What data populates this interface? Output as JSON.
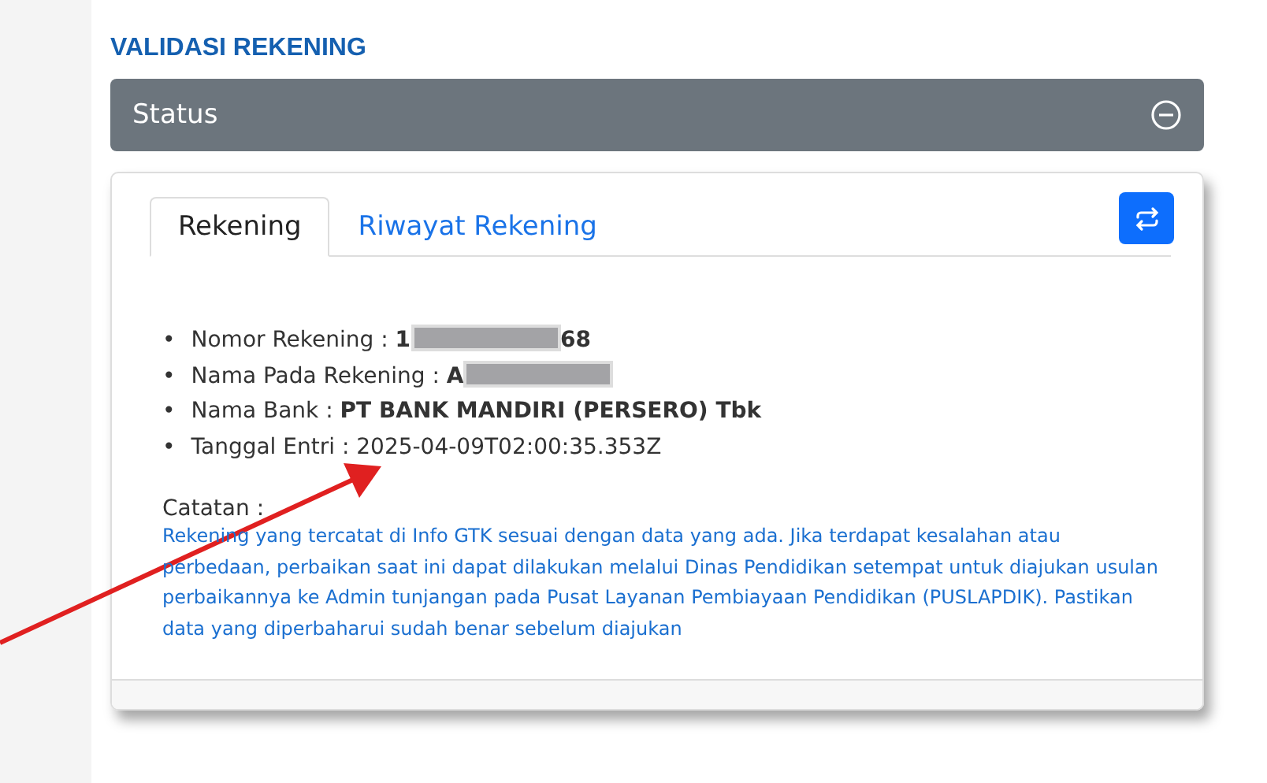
{
  "heading": "VALIDASI REKENING",
  "status_bar": {
    "title": "Status",
    "expanded": true
  },
  "tabs": [
    {
      "label": "Rekening",
      "selected": true
    },
    {
      "label": "Riwayat Rekening",
      "selected": false
    }
  ],
  "details": [
    {
      "marker": "•",
      "label": "Nomor Rekening :",
      "value": [
        {
          "kind": "text",
          "text": "1"
        },
        {
          "kind": "redacted"
        },
        {
          "kind": "text",
          "text": "68"
        }
      ],
      "bold": true
    },
    {
      "marker": "•",
      "label": "Nama Pada Rekening :",
      "value": [
        {
          "kind": "text",
          "text": "A"
        },
        {
          "kind": "redacted"
        }
      ],
      "bold": true
    },
    {
      "marker": "•",
      "label": "Nama Bank :",
      "value": [
        {
          "kind": "text",
          "text": "PT BANK MANDIRI (PERSERO) Tbk"
        }
      ],
      "bold": true
    },
    {
      "marker": "•",
      "label": "Tanggal Entri :",
      "value": [
        {
          "kind": "text",
          "text": "2025-04-09T02:00:35.353Z"
        }
      ],
      "bold": false
    }
  ],
  "note": {
    "label": "Catatan :",
    "text": "Rekening yang tercatat di Info GTK sesuai dengan data yang ada. Jika terdapat kesalahan atau perbedaan, perbaikan saat ini dapat dilakukan melalui Dinas Pendidikan setempat untuk diajukan usulan perbaikannya ke Admin tunjangan pada Pusat Layanan Pembiayaan Pendidikan (PUSLAPDIK). Pastikan data yang diperbaharui sudah benar sebelum diajukan"
  }
}
